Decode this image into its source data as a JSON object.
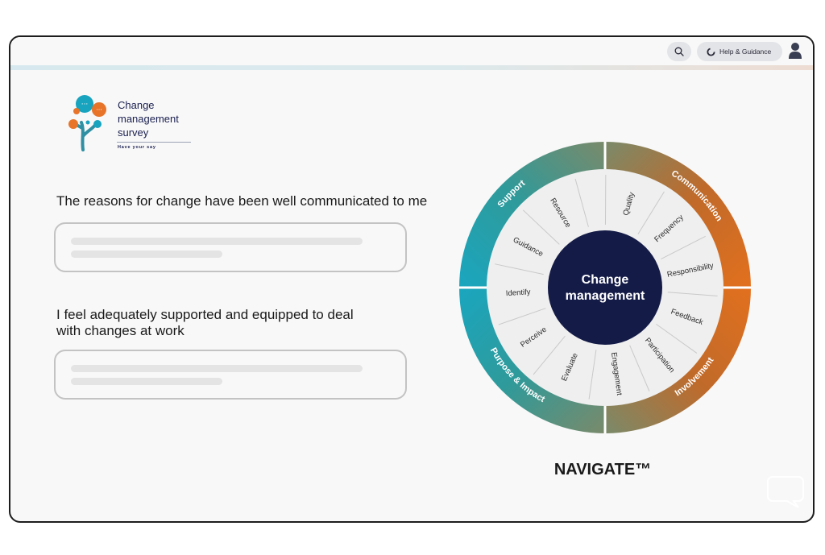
{
  "header": {
    "search_icon": "search-icon",
    "help_label": "Help & Guidance",
    "help_icon": "spinner-icon",
    "user_icon": "user-icon"
  },
  "logo": {
    "line1": "Change",
    "line2": "management",
    "line3": "survey",
    "tagline": "Have your say"
  },
  "questions": [
    {
      "text": "The reasons for change have been well communicated to me"
    },
    {
      "line1": "I feel adequately supported and equipped to deal",
      "line2": "with changes at work"
    }
  ],
  "wheel": {
    "center_line1": "Change",
    "center_line2": "management",
    "outer": [
      "Communication",
      "Involvement",
      "Purpose & Impact",
      "Support"
    ],
    "inner": [
      "Quality",
      "Frequency",
      "Responsibility",
      "Feedback",
      "Participation",
      "Engagement",
      "Evaluate",
      "Perceive",
      "Identify",
      "Guidance",
      "Resource"
    ],
    "colors": {
      "center": "#141b47",
      "teal": "#1aa6bf",
      "orange": "#e2701e",
      "olive": "#7a8a6a",
      "inner_ring": "#efefef"
    }
  },
  "brand": {
    "label": "NAVIGATE™"
  },
  "chat_icon": "chat-bubble-icon"
}
